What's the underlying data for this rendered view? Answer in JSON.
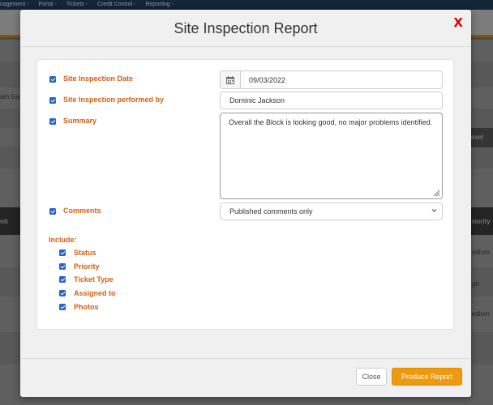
{
  "background": {
    "nav_items": [
      "nagement -",
      "Portal -",
      "Tickets -",
      "Credit Control -",
      "Reporting -"
    ],
    "left_snippet": "am Ga",
    "reset_label": "eset",
    "col_left": "nit",
    "col_right": "riority",
    "row_values": [
      "edium",
      "gh",
      "edium"
    ]
  },
  "modal": {
    "title": "Site Inspection Report",
    "close_glyph": "X",
    "fields": {
      "inspection_date_label": "Site Inspection Date",
      "inspection_date_value": "09/03/2022",
      "performed_by_label": "Site Inspection performed by",
      "performed_by_value": "Dominic Jackson",
      "summary_label": "Summary",
      "summary_value": "Overall the Block is looking good, no major problems identified.",
      "comments_label": "Comments",
      "comments_selected": "Published comments only"
    },
    "include_label": "Include:",
    "include_items": [
      "Status",
      "Priority",
      "Ticket Type",
      "Assigned to",
      "Photos"
    ],
    "footer": {
      "close_label": "Close",
      "produce_label": "Produce Report"
    }
  },
  "icons": {
    "calendar": "calendar-icon",
    "checkbox": "checkbox-checked-icon",
    "chevron": "chevron-down-icon",
    "resize": "resize-grip-icon"
  },
  "colors": {
    "label_orange": "#d75d12",
    "checkbox_blue": "#2563c9",
    "produce_button": "#ee9a10",
    "close_x": "#e00000",
    "nav_bg": "#1d3c5c"
  }
}
